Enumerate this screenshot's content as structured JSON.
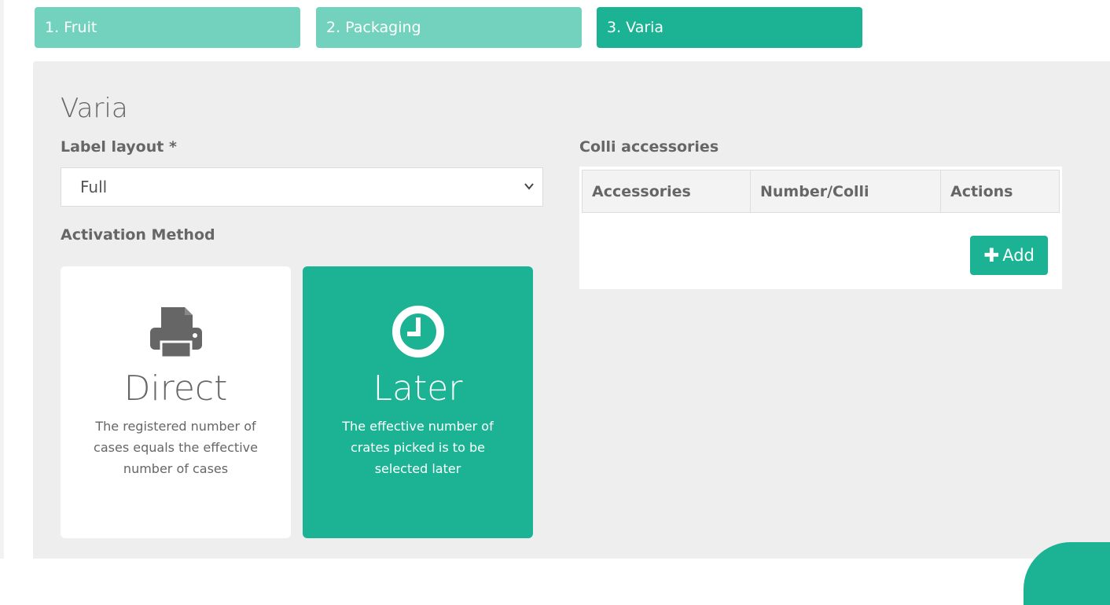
{
  "steps": [
    {
      "label": "1. Fruit"
    },
    {
      "label": "2. Packaging"
    },
    {
      "label": "3. Varia"
    }
  ],
  "section": {
    "title": "Varia",
    "label_layout_label": "Label layout *",
    "label_layout_value": "Full",
    "activation_label": "Activation Method",
    "methods": {
      "direct": {
        "title": "Direct",
        "description": "The registered number of cases equals the effective number of cases",
        "icon": "printer-icon"
      },
      "later": {
        "title": "Later",
        "description": "The effective number of crates picked is to be selected later",
        "icon": "clock-icon"
      }
    },
    "selected_method": "Later"
  },
  "colli": {
    "label": "Colli accessories",
    "columns": [
      "Accessories",
      "Number/Colli",
      "Actions"
    ],
    "add_label": "Add"
  },
  "colors": {
    "accent": "#1bb394",
    "accent_light": "#72d2bd",
    "panel_bg": "#eeeeee"
  }
}
